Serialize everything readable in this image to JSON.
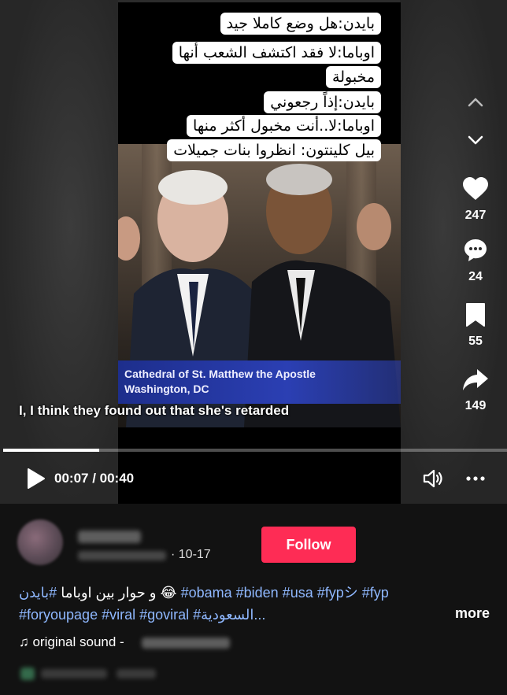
{
  "video": {
    "captions": [
      "بايدن:هل وضع كاملا جيد",
      "اوباما:لا فقد اكتشف الشعب أنها",
      "مخبولة",
      "بايدن:إذاً رجعوني",
      "اوباما:لا..أنت مخبول أكثر منها",
      "بيل كلينتون: انظروا بنات جميلات"
    ],
    "lower_third": {
      "line1": "Cathedral of St. Matthew the Apostle",
      "line2": "Washington, DC"
    },
    "subtitle": "I, I think they found out that she's retarded"
  },
  "controls": {
    "time": "00:07 / 00:40",
    "progress": 0.19
  },
  "actions": {
    "likes": "247",
    "comments": "24",
    "saves": "55",
    "shares": "149"
  },
  "author": {
    "date": "· 10-17",
    "follow_label": "Follow"
  },
  "description": {
    "line1_prefix": "و",
    "line1_arabic": "حوار بين اوباما",
    "line1_tag1": "#بايدن",
    "line1_emoji": "😂",
    "line1_tags": "#obama #biden #usa #fypシ #fyp",
    "line2_tags": "#foryoupage #viral #goviral #السعودية...",
    "more_label": "more"
  },
  "sound": {
    "label": "♫ original sound -"
  },
  "colors": {
    "follow": "#fe2c55",
    "hashtag": "#8fb8ff",
    "news_banner": "#2b3fb3"
  },
  "icons": [
    "chevron-up-icon",
    "chevron-down-icon",
    "heart-icon",
    "comment-icon",
    "bookmark-icon",
    "share-icon",
    "play-icon",
    "volume-icon",
    "more-icon",
    "music-note-icon"
  ]
}
